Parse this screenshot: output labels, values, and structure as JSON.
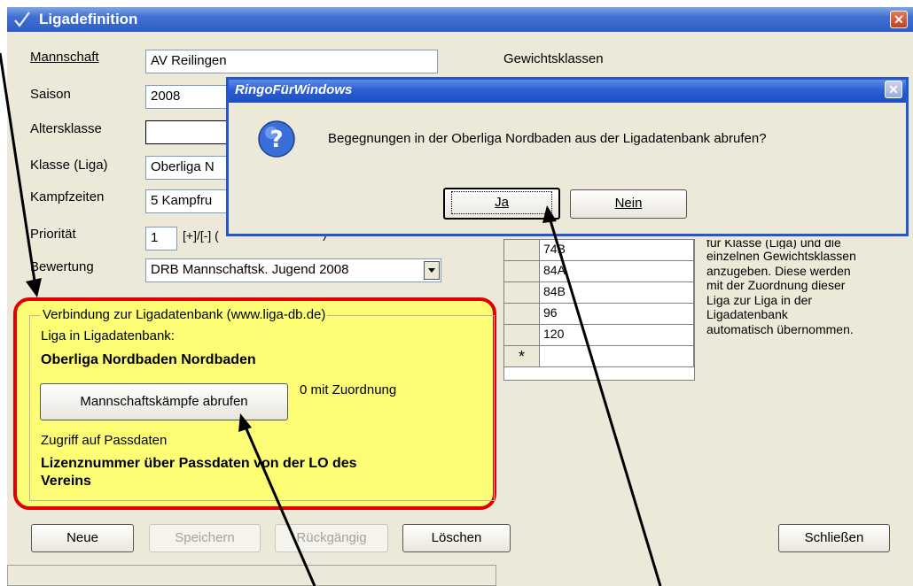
{
  "window": {
    "title": "Ligadefinition"
  },
  "form": {
    "mannschaft": {
      "label": "Mannschaft",
      "value": "AV Reilingen"
    },
    "saison": {
      "label": "Saison",
      "value": "2008"
    },
    "altersklasse": {
      "label": "Altersklasse",
      "value": ""
    },
    "klasse": {
      "label": "Klasse (Liga)",
      "value": "Oberliga N"
    },
    "kampfzeiten": {
      "label": "Kampfzeiten",
      "value": "5 Kampfru"
    },
    "prioritaet": {
      "label": "Priorität",
      "value": "1",
      "hint": "[+]/[-] (",
      "hint_tail": ")"
    },
    "bewertung": {
      "label": "Bewertung",
      "value": "DRB Mannschaftsk. Jugend 2008"
    }
  },
  "gewichtsklassen": {
    "label": "Gewichtsklassen",
    "rows": [
      "74B",
      "84A",
      "84B",
      "96",
      "120"
    ],
    "new_row_marker": "*",
    "help_lines": [
      "für Klasse (Liga) und die",
      "einzelnen Gewichtsklassen",
      "anzugeben. Diese werden",
      "mit der Zuordnung dieser",
      "Liga zur Liga in der",
      "Ligadatenbank",
      "automatisch übernommen."
    ]
  },
  "ligadb": {
    "group_label": "Verbindung zur Ligadatenbank (www.liga-db.de)",
    "liga_label": "Liga in Ligadatenbank:",
    "liga_value": "Oberliga Nordbaden Nordbaden",
    "fetch_button": "Mannschaftskämpfe abrufen",
    "match_count": "0 mit Zuordnung",
    "passdaten_label": "Zugriff auf Passdaten",
    "passdaten_value_1": "Lizenznummer über Passdaten von der LO des",
    "passdaten_value_2": "Vereins"
  },
  "buttons": {
    "neue": "Neue",
    "speichern": "Speichern",
    "rueckgaengig": "Rückgängig",
    "loeschen": "Löschen",
    "schliessen": "Schließen"
  },
  "dialog": {
    "title": "RingoFürWindows",
    "message": "Begegnungen in der Oberliga Nordbaden aus der Ligadatenbank abrufen?",
    "yes": "Ja",
    "no": "Nein"
  },
  "colors": {
    "annotation_red": "#e00000",
    "highlight_yellow": "#fdfd75",
    "xp_blue": "#2b5fd4"
  }
}
